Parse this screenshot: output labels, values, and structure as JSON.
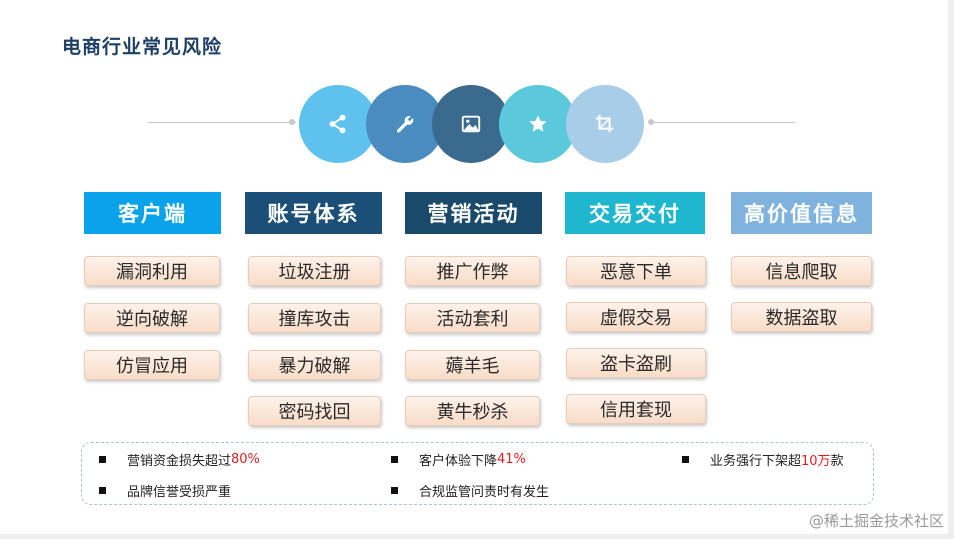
{
  "title": "电商行业常见风险",
  "categories": [
    {
      "label": "客户端",
      "color": "#0aa2ea",
      "items": [
        "漏洞利用",
        "逆向破解",
        "仿冒应用"
      ]
    },
    {
      "label": "账号体系",
      "color": "#1c4f78",
      "items": [
        "垃圾注册",
        "撞库攻击",
        "暴力破解",
        "密码找回"
      ]
    },
    {
      "label": "营销活动",
      "color": "#1a4a6b",
      "items": [
        "推广作弊",
        "活动套利",
        "薅羊毛",
        "黄牛秒杀"
      ]
    },
    {
      "label": "交易交付",
      "color": "#1fb6cf",
      "items": [
        "恶意下单",
        "虚假交易",
        "盗卡盗刷",
        "信用套现"
      ]
    },
    {
      "label": "高价值信息",
      "color": "#7fb2dc",
      "items": [
        "信息爬取",
        "数据盗取"
      ]
    }
  ],
  "icons": [
    {
      "name": "share-icon",
      "color": "#5ec1ee"
    },
    {
      "name": "wrench-icon",
      "color": "#4a8bc0"
    },
    {
      "name": "image-icon",
      "color": "#3a6a8e"
    },
    {
      "name": "star-icon",
      "color": "#5cc8dc"
    },
    {
      "name": "crop-icon",
      "color": "#a8cde9"
    }
  ],
  "impacts": [
    {
      "text": "营销资金损失超过",
      "highlight": "80%"
    },
    {
      "text": "客户体验下降",
      "highlight": "41%"
    },
    {
      "text": "业务强行下架超",
      "highlight": "10万",
      "suffix": "款"
    },
    {
      "text": "品牌信誉受损严重"
    },
    {
      "text": "合规监管问责时有发生"
    }
  ],
  "watermark": "@稀土掘金技术社区"
}
